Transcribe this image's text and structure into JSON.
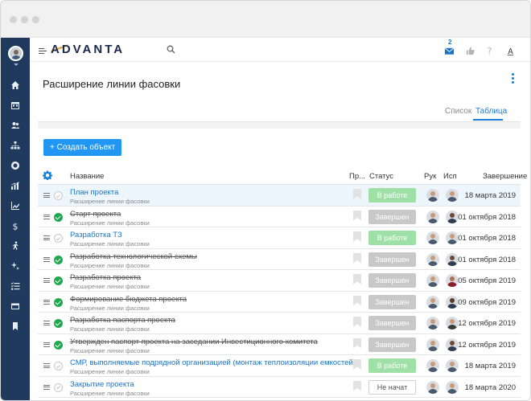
{
  "app": {
    "logo": "ADVANTA",
    "notification_count": "2"
  },
  "page": {
    "title": "Расширение линии фасовки",
    "tabs": [
      {
        "label": "Список",
        "active": false
      },
      {
        "label": "Таблица",
        "active": true
      }
    ],
    "create_button": "+ Создать объект"
  },
  "table": {
    "columns": {
      "name": "Название",
      "priority": "Пр...",
      "status": "Статус",
      "manager": "Рук",
      "executor": "Исп",
      "end": "Завершение"
    },
    "rows": [
      {
        "name": "План проекта",
        "subtitle": "Расширение линии фасовки",
        "done": false,
        "status": "В работе",
        "status_kind": "work",
        "date": "18 марта 2019"
      },
      {
        "name": "Старт проекта",
        "subtitle": "Расширение линии фасовки",
        "done": true,
        "status": "Завершен",
        "status_kind": "done",
        "date": "01 октября 2018"
      },
      {
        "name": "Разработка ТЗ",
        "subtitle": "Расширение линии фасовки",
        "done": false,
        "status": "В работе",
        "status_kind": "work",
        "date": "01 октября 2018"
      },
      {
        "name": "Разработка технологической схемы",
        "subtitle": "Расширение линии фасовки",
        "done": true,
        "status": "Завершен",
        "status_kind": "done",
        "date": "01 октября 2018"
      },
      {
        "name": "Разработка проекта",
        "subtitle": "Расширение линии фасовки",
        "done": true,
        "status": "Завершен",
        "status_kind": "done",
        "date": "05 октября 2019"
      },
      {
        "name": "Формирование бюджета проекта",
        "subtitle": "Расширение линии фасовки",
        "done": true,
        "status": "Завершен",
        "status_kind": "done",
        "date": "09 октября 2019"
      },
      {
        "name": "Разработка паспорта проекта",
        "subtitle": "Расширение линии фасовки",
        "done": true,
        "status": "Завершен",
        "status_kind": "done",
        "date": "12 октября 2019"
      },
      {
        "name": "Утвержден паспорт проекта на заседании Инвестиционного комитета",
        "subtitle": "Расширение линии фасовки",
        "done": true,
        "status": "Завершен",
        "status_kind": "done",
        "date": "12 октября 2019"
      },
      {
        "name": "СМР, выполняемые подрядной организацией (монтаж теплоизоляции емкостей)",
        "subtitle": "Расширение линии фасовки",
        "done": false,
        "status": "В работе",
        "status_kind": "work",
        "date": "18 марта 2019"
      },
      {
        "name": "Закрытие проекта",
        "subtitle": "Расширение линии фасовки",
        "done": false,
        "status": "Не начат",
        "status_kind": "new",
        "date": "18 марта 2020"
      }
    ]
  },
  "colors": {
    "sidebar": "#1f3a5c",
    "accent": "#2196f3",
    "link": "#1a73c9",
    "done_check": "#1fa84f",
    "status_work": "#9ee0a6",
    "status_done": "#c8c8c8"
  }
}
